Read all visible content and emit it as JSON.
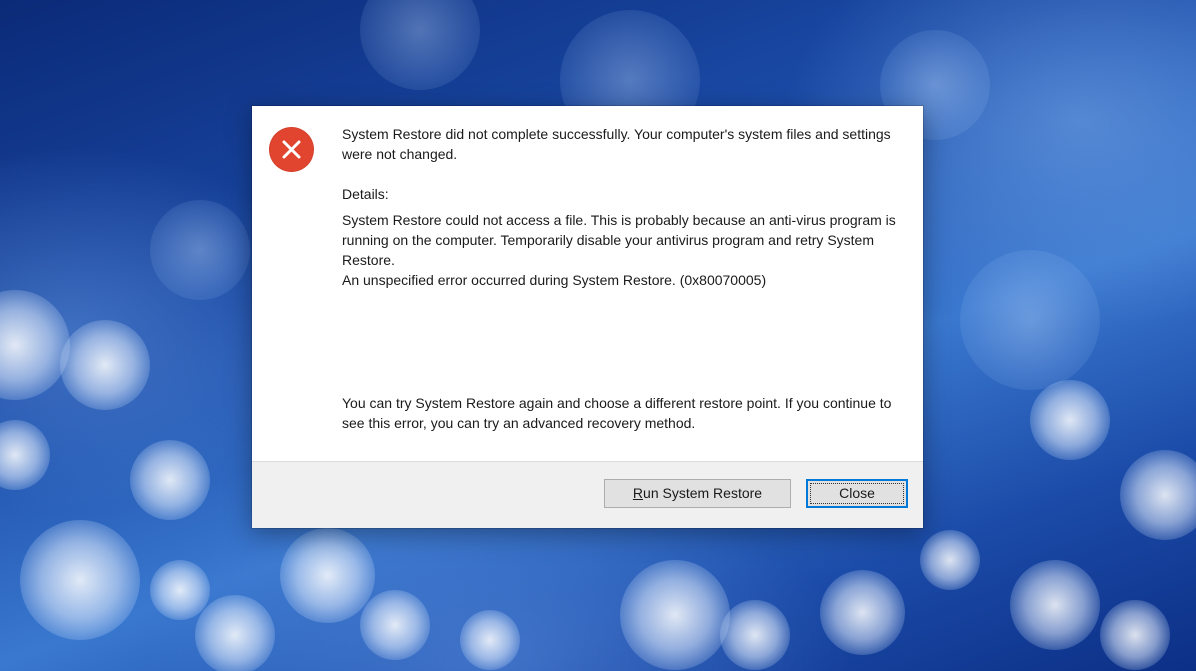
{
  "dialog": {
    "icon": "error-icon",
    "icon_color": "#e2452f",
    "message": "System Restore did not complete successfully. Your computer's system files and settings were not changed.",
    "details_label": "Details:",
    "details_text": "System Restore could not access a file. This is probably because an anti-virus program is running on the computer. Temporarily disable your antivirus program and retry System Restore.\nAn unspecified error occurred during System Restore. (0x80070005)",
    "hint_text": "You can try System Restore again and choose a different restore point. If you continue to see this error, you can try an advanced recovery method.",
    "buttons": {
      "run_accel": "R",
      "run_rest": "un System Restore",
      "close": "Close"
    },
    "focus_color": "#0078d7"
  }
}
